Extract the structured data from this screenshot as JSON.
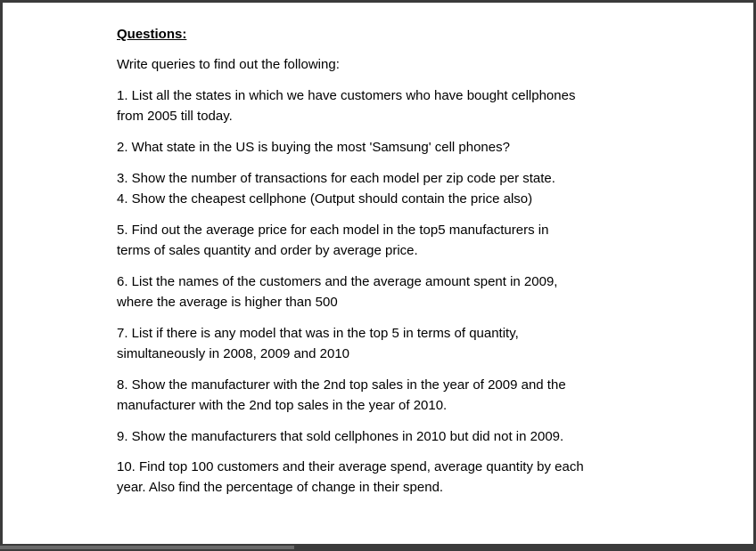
{
  "document": {
    "heading": "Questions:",
    "intro": "Write queries to find out the following:",
    "questions": [
      {
        "lines": [
          "1. List all the states in which we have customers who have bought cellphones",
          "from 2005 till today."
        ]
      },
      {
        "lines": [
          "2. What state in the US is buying the most 'Samsung' cell phones?"
        ]
      },
      {
        "lines": [
          "3. Show the number of transactions for each model per zip code per state."
        ]
      },
      {
        "lines": [
          "4. Show the cheapest cellphone (Output should contain the price also)"
        ]
      },
      {
        "lines": [
          "5. Find out the average price for each model in the top5 manufacturers in",
          "terms of sales quantity and order by average price."
        ]
      },
      {
        "lines": [
          "6. List the names of the customers and the average amount spent in 2009,",
          "where the average is higher than 500"
        ]
      },
      {
        "lines": [
          "7. List if there is any model that was in the top 5 in terms of quantity,",
          "simultaneously in 2008, 2009 and 2010"
        ]
      },
      {
        "lines": [
          "8. Show the manufacturer with the 2nd top sales in the year of 2009 and the",
          "manufacturer with the 2nd top sales in the year of 2010."
        ]
      },
      {
        "lines": [
          "9. Show the manufacturers that sold cellphones in 2010 but did not in 2009."
        ]
      },
      {
        "lines": [
          "10. Find top 100 customers and their average spend, average quantity by each",
          "year. Also find the percentage of change in their spend."
        ]
      }
    ]
  }
}
